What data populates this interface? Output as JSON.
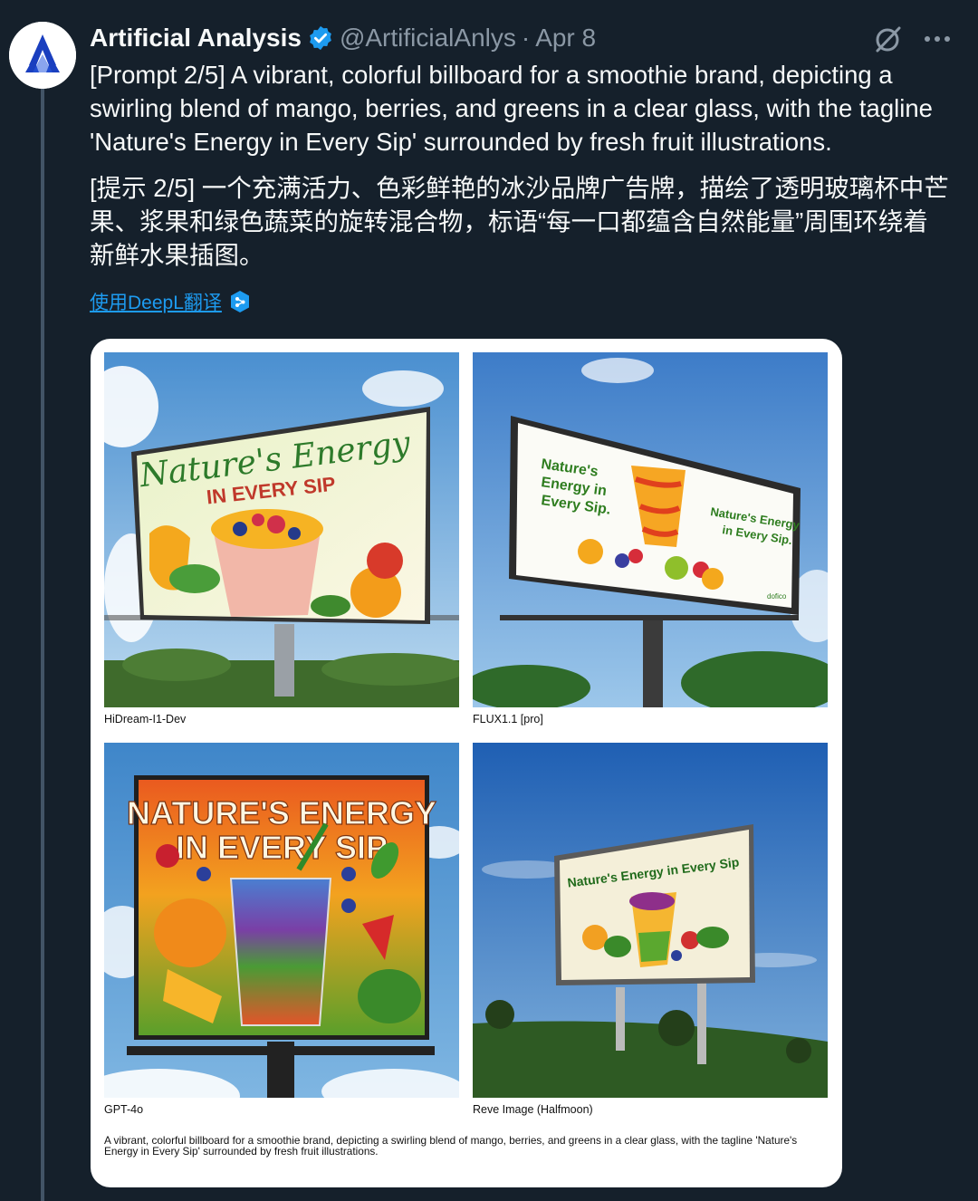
{
  "author": {
    "display_name": "Artificial Analysis",
    "handle": "@ArtificialAnlys",
    "separator": "·",
    "timestamp": "Apr 8",
    "avatar_icon": "artificial-analysis-logo",
    "verified_icon": "verified-badge-icon",
    "verified_color": "#1d9bf0"
  },
  "actions": {
    "grok_icon": "grok-icon",
    "more_icon": "more-options-icon"
  },
  "tweet": {
    "text_en": "[Prompt 2/5] A vibrant, colorful billboard for a smoothie brand, depicting a swirling blend of mango, berries, and greens in a clear glass, with the tagline 'Nature's Energy in Every Sip' surrounded by fresh fruit illustrations.",
    "text_zh": "[提示 2/5] 一个充满活力、色彩鲜艳的冰沙品牌广告牌，描绘了透明玻璃杯中芒果、浆果和绿色蔬菜的旋转混合物，标语“每一口都蕴含自然能量”周围环绕着新鲜水果插图。",
    "translate_label": "使用DeepL翻译",
    "translate_icon": "deepl-icon"
  },
  "media": {
    "panels": [
      {
        "caption": "HiDream-I1-Dev",
        "billboard_line1": "Nature's Energy",
        "billboard_line2": "IN EVERY SIP"
      },
      {
        "caption": "FLUX1.1 [pro]",
        "billboard_left": [
          "Nature's",
          "Energy in",
          "Every Sip."
        ],
        "billboard_right": [
          "Nature's Energy",
          "in Every Sip."
        ],
        "brand": "dofico"
      },
      {
        "caption": "GPT-4o",
        "billboard_line1": "NATURE'S ENERGY",
        "billboard_line2": "IN EVERY SIP"
      },
      {
        "caption": "Reve Image (Halfmoon)",
        "billboard_line1": "Nature's Energy in Every Sip"
      }
    ],
    "footnote": "A vibrant, colorful billboard for a smoothie brand, depicting a swirling blend of mango, berries, and greens in a clear glass, with the tagline 'Nature's Energy in Every Sip' surrounded by fresh fruit illustrations."
  }
}
